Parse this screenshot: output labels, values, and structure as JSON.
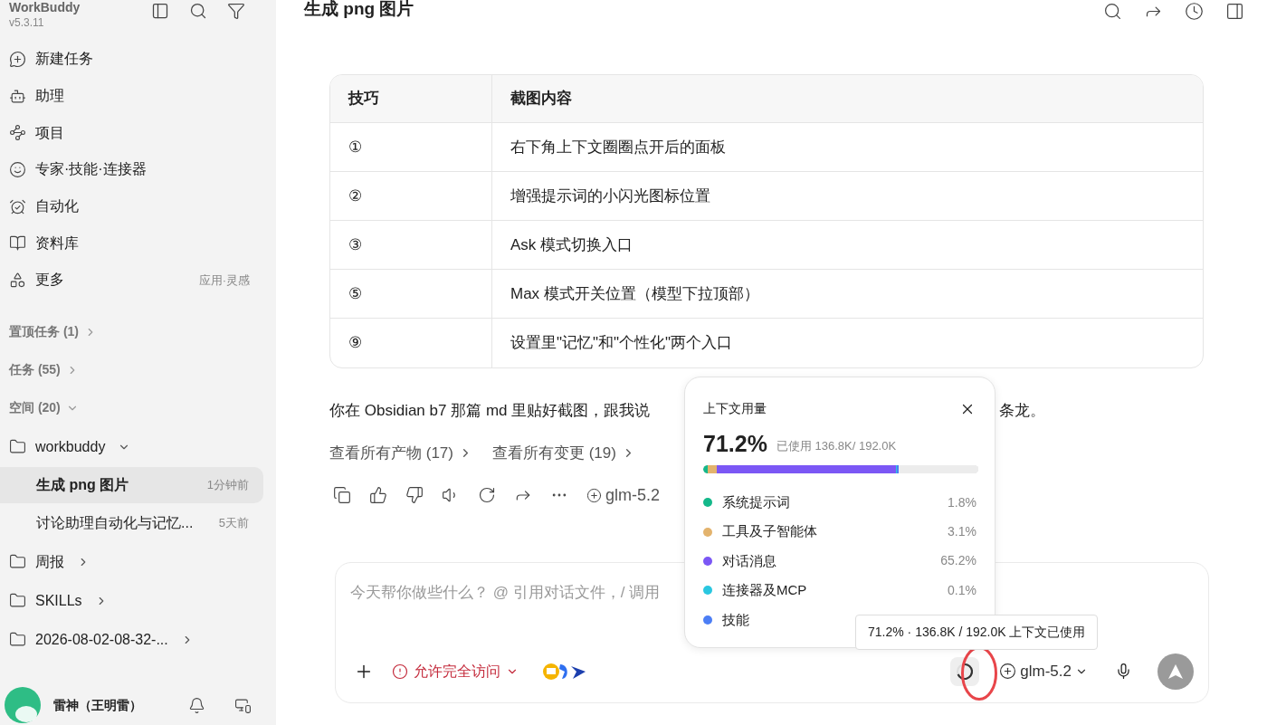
{
  "sidebar": {
    "app_name": "WorkBuddy",
    "version": "v5.3.11",
    "nav": [
      {
        "kind": "new",
        "label": "新建任务"
      },
      {
        "kind": "assistant",
        "label": "助理"
      },
      {
        "kind": "project",
        "label": "项目"
      },
      {
        "kind": "expert",
        "label": "专家·技能·连接器"
      },
      {
        "kind": "automation",
        "label": "自动化"
      },
      {
        "kind": "library",
        "label": "资料库"
      },
      {
        "kind": "more",
        "label": "更多",
        "hint": "应用·灵感"
      }
    ],
    "sections": [
      {
        "label": "置顶任务 (1)",
        "expanded": false
      },
      {
        "label": "任务 (55)",
        "expanded": false
      },
      {
        "label": "空间 (20)",
        "expanded": true
      }
    ],
    "folders": [
      {
        "name": "workbuddy",
        "expanded": true,
        "children": [
          {
            "title": "生成 png 图片",
            "time": "1分钟前",
            "selected": true
          },
          {
            "title": "讨论助理自动化与记忆...",
            "time": "5天前",
            "selected": false
          }
        ]
      },
      {
        "name": "周报",
        "expanded": false
      },
      {
        "name": "SKILLs",
        "expanded": false
      },
      {
        "name": "2026-08-02-08-32-...",
        "expanded": false
      }
    ],
    "user": {
      "name": "雷神（王明雷）"
    }
  },
  "header": {
    "title": "生成 png 图片"
  },
  "table": {
    "columns": [
      "技巧",
      "截图内容"
    ],
    "rows": [
      [
        "①",
        "右下角上下文圈圈点开后的面板"
      ],
      [
        "②",
        "增强提示词的小闪光图标位置"
      ],
      [
        "③",
        "Ask 模式切换入口"
      ],
      [
        "⑤",
        "Max 模式开关位置（模型下拉顶部）"
      ],
      [
        "⑨",
        "设置里\"记忆\"和\"个性化\"两个入口"
      ]
    ]
  },
  "message": {
    "text": "你在 Obsidian b7 那篇 md 里贴好截图，跟我说",
    "text_tail": "条龙。",
    "links": [
      "查看所有产物 (17)",
      "查看所有变更 (19)"
    ],
    "model": "glm-5.2"
  },
  "composer": {
    "placeholder": "今天帮你做些什么？ @ 引用对话文件，/ 调用",
    "access": "允许完全访问",
    "model": "glm-5.2"
  },
  "context_popover": {
    "title": "上下文用量",
    "percent": "71.2%",
    "usage": "已使用 136.8K/ 192.0K",
    "items": [
      {
        "label": "系统提示词",
        "value": "1.8%",
        "color": "#14b88a",
        "level": 0.018
      },
      {
        "label": "工具及子智能体",
        "value": "3.1%",
        "color": "#e3b36d",
        "level": 0.031
      },
      {
        "label": "对话消息",
        "value": "65.2%",
        "color": "#7b57f5",
        "level": 0.652
      },
      {
        "label": "连接器及MCP",
        "value": "0.1%",
        "color": "#2ac7e0",
        "level": 0.003
      },
      {
        "label": "技能",
        "color": "#4c7ef5",
        "level": 0.008
      }
    ]
  },
  "tooltip": {
    "text": "71.2% · 136.8K / 192.0K 上下文已使用"
  }
}
